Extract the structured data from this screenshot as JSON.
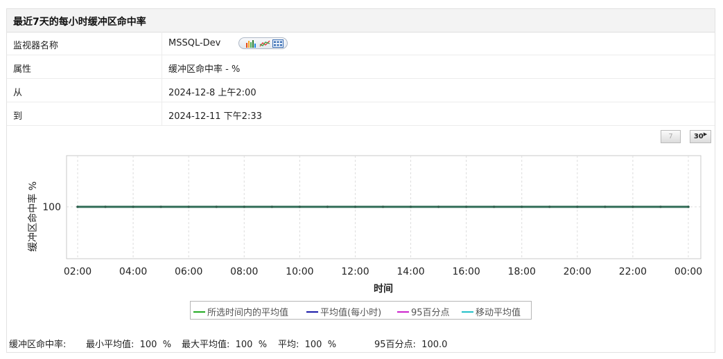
{
  "header": {
    "title": "最近7天的每小时缓冲区命中率"
  },
  "info_rows": [
    {
      "label": "监视器名称",
      "value": "MSSQL-Dev"
    },
    {
      "label": "属性",
      "value": "缓冲区命中率 - %"
    },
    {
      "label": "从",
      "value": "2024-12-8 上午2:00"
    },
    {
      "label": "到",
      "value": "2024-12-11 下午2:33"
    }
  ],
  "view_icons": [
    "bar-chart-icon",
    "line-chart-icon",
    "table-icon"
  ],
  "period_buttons": [
    {
      "label": "7",
      "enabled": false
    },
    {
      "label": "30",
      "enabled": true
    }
  ],
  "chart_data": {
    "type": "line",
    "ylabel": "缓冲区命中率 %",
    "xlabel": "时间",
    "x_ticks": [
      "02:00",
      "04:00",
      "06:00",
      "08:00",
      "10:00",
      "12:00",
      "14:00",
      "16:00",
      "18:00",
      "20:00",
      "22:00",
      "00:00"
    ],
    "y_ticks": [
      100
    ],
    "grid": true,
    "x_hours": [
      2,
      3,
      4,
      5,
      6,
      7,
      8,
      9,
      10,
      11,
      12,
      13,
      14,
      15,
      16,
      17,
      18,
      19,
      20,
      21,
      22,
      23,
      24
    ],
    "series": [
      {
        "name": "所选时间内的平均值",
        "color": "#22aa22",
        "values": [
          100,
          100,
          100,
          100,
          100,
          100,
          100,
          100,
          100,
          100,
          100,
          100,
          100,
          100,
          100,
          100,
          100,
          100,
          100,
          100,
          100,
          100,
          100
        ]
      },
      {
        "name": "平均值(每小时)",
        "color": "#1a1aa8",
        "values": [
          100,
          100,
          100,
          100,
          100,
          100,
          100,
          100,
          100,
          100,
          100,
          100,
          100,
          100,
          100,
          100,
          100,
          100,
          100,
          100,
          100,
          100,
          100
        ]
      },
      {
        "name": "95百分点",
        "color": "#cc22cc",
        "values": [
          100,
          100,
          100,
          100,
          100,
          100,
          100,
          100,
          100,
          100,
          100,
          100,
          100,
          100,
          100,
          100,
          100,
          100,
          100,
          100,
          100,
          100,
          100
        ]
      },
      {
        "name": "移动平均值",
        "color": "#22c0c8",
        "values": [
          100,
          100,
          100,
          100,
          100,
          100,
          100,
          100,
          100,
          100,
          100,
          100,
          100,
          100,
          100,
          100,
          100,
          100,
          100,
          100,
          100,
          100,
          100
        ]
      }
    ],
    "legend_position": "bottom"
  },
  "stats": {
    "metric_label": "缓冲区命中率:",
    "min_avg": "最小平均值:  100  %",
    "max_avg": "最大平均值:  100  %",
    "avg": "平均:  100  %",
    "p95": "95百分点:  100.0"
  }
}
